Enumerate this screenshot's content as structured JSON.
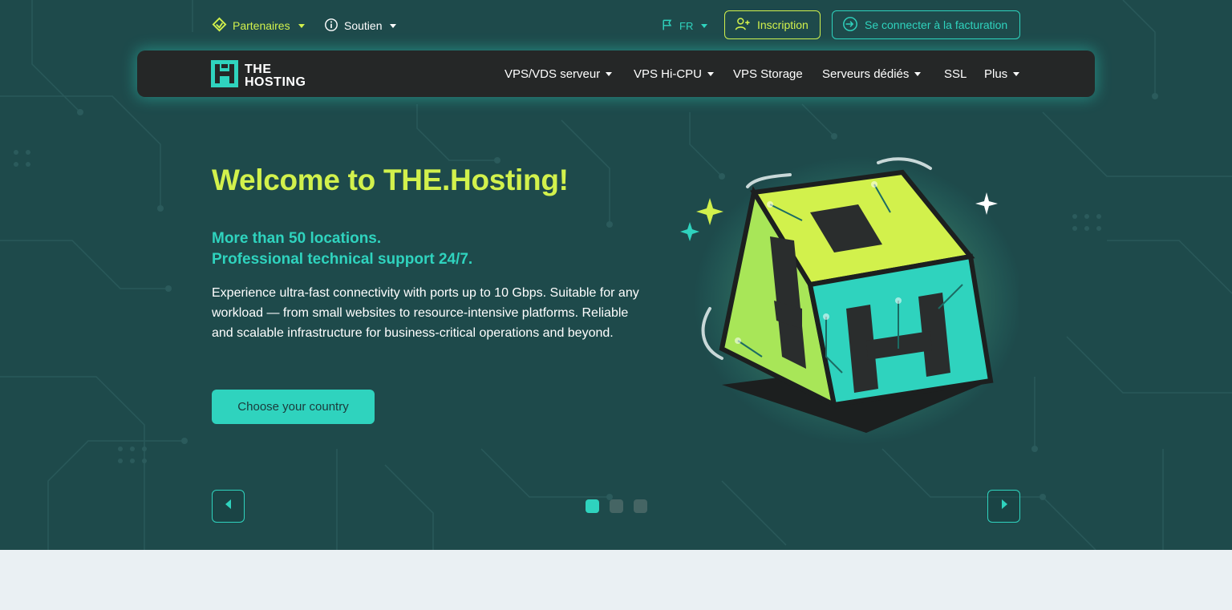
{
  "topbar": {
    "partners": "Partenaires",
    "support": "Soutien",
    "language": "FR",
    "signup": "Inscription",
    "login": "Se connecter à la facturation"
  },
  "logo": {
    "line1": "THE",
    "line2": "HOSTING"
  },
  "nav": {
    "items": [
      {
        "label": "VPS/VDS serveur",
        "dropdown": true
      },
      {
        "label": "VPS Hi-CPU",
        "dropdown": true
      },
      {
        "label": "VPS Storage",
        "dropdown": false
      },
      {
        "label": "Serveurs dédiés",
        "dropdown": true
      },
      {
        "label": "SSL",
        "dropdown": false
      },
      {
        "label": "Plus",
        "dropdown": true
      }
    ]
  },
  "hero": {
    "title": "Welcome to THE.Hosting!",
    "subtitle_line1": "More than 50 locations.",
    "subtitle_line2": "Professional technical support 24/7.",
    "description": "Experience ultra-fast connectivity with ports up to 10 Gbps. Suitable for any workload — from small websites to resource-intensive platforms. Reliable and scalable infrastructure for business-critical operations and beyond.",
    "cta": "Choose your country"
  },
  "slider": {
    "active_index": 0,
    "slide_count": 3
  },
  "colors": {
    "hero_bg": "#1e4a4b",
    "accent_teal": "#2fd3be",
    "accent_lime": "#d2f14c",
    "navbar_bg": "#252727",
    "page_bg": "#eaf0f3"
  },
  "icons": {
    "partners": "handshake-diamond-icon",
    "support": "info-circle-icon",
    "language": "flag-icon",
    "signup": "user-plus-icon",
    "login": "sign-in-icon"
  }
}
